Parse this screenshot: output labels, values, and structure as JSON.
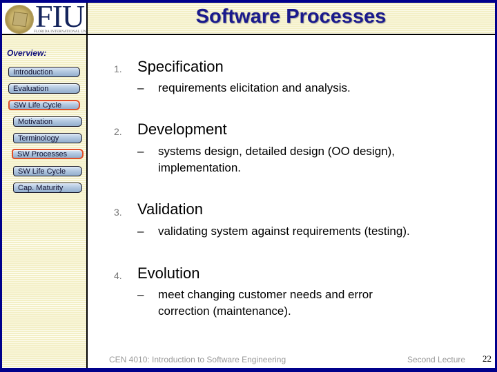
{
  "header": {
    "logo_text": "FIU",
    "logo_subtitle": "FLORIDA INTERNATIONAL UNIVERSITY",
    "title": "Software Processes"
  },
  "sidebar": {
    "heading": "Overview:",
    "items": [
      {
        "label": "Introduction",
        "level": 1,
        "active": false
      },
      {
        "label": "Evaluation",
        "level": 1,
        "active": false
      },
      {
        "label": "SW Life Cycle",
        "level": 1,
        "active": true
      },
      {
        "label": "Motivation",
        "level": 2,
        "active": false
      },
      {
        "label": "Terminology",
        "level": 2,
        "active": false
      },
      {
        "label": "SW Processes",
        "level": 2,
        "active": true
      },
      {
        "label": "SW Life Cycle",
        "level": 2,
        "active": false
      },
      {
        "label": "Cap. Maturity",
        "level": 2,
        "active": false
      }
    ]
  },
  "content": {
    "items": [
      {
        "number": "1.",
        "heading": "Specification",
        "dash": "–",
        "detail": "requirements elicitation and analysis."
      },
      {
        "number": "2.",
        "heading": "Development",
        "dash": "–",
        "detail": "systems design, detailed design (OO design), implementation."
      },
      {
        "number": "3.",
        "heading": "Validation",
        "dash": "–",
        "detail": "validating system against requirements (testing)."
      },
      {
        "number": "4.",
        "heading": "Evolution",
        "dash": "–",
        "detail": "meet changing customer needs and error correction (maintenance)."
      }
    ]
  },
  "footer": {
    "course": "CEN 4010: Introduction to Software Engineering",
    "lecture": "Second Lecture",
    "page_number": "22"
  },
  "colors": {
    "frame": "#00008b",
    "title": "#1a1a8c",
    "active_outline": "#e0502a"
  }
}
